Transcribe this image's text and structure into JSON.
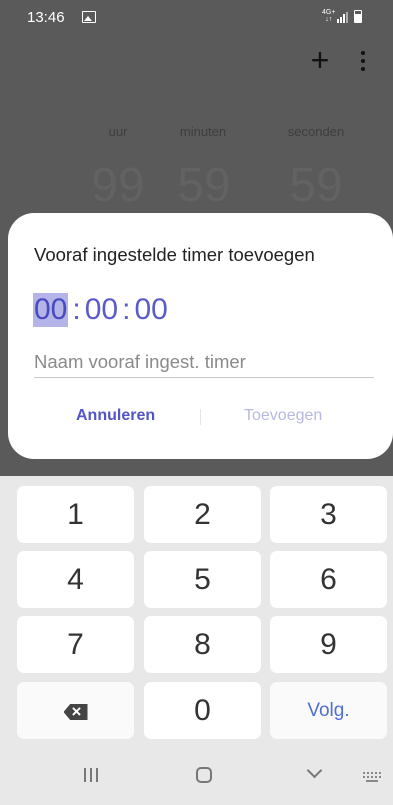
{
  "status_bar": {
    "time": "13:46",
    "network_type": "4G+",
    "icons": [
      "image-icon",
      "network-arrows-icon",
      "signal-icon",
      "battery-icon"
    ]
  },
  "app_bar": {
    "add_icon": "+",
    "more_icon": "more-vertical-icon"
  },
  "background_timer": {
    "columns": [
      {
        "label": "uur",
        "value": "99"
      },
      {
        "label": "minuten",
        "value": "59"
      },
      {
        "label": "seconden",
        "value": "59"
      }
    ]
  },
  "dialog": {
    "title": "Vooraf ingestelde timer toevoegen",
    "hours": "00",
    "minutes": "00",
    "seconds": "00",
    "separator": ":",
    "name_placeholder": "Naam vooraf ingest. timer",
    "name_value": "",
    "cancel_label": "Annuleren",
    "add_label": "Toevoegen",
    "colors": {
      "accent": "#5454c8",
      "highlight": "#b4b4e8",
      "disabled": "#b8b8e4"
    }
  },
  "keypad": {
    "keys": [
      "1",
      "2",
      "3",
      "4",
      "5",
      "6",
      "7",
      "8",
      "9",
      "",
      "0",
      "Volg."
    ],
    "backspace_icon": "backspace-icon"
  },
  "nav_bar": {
    "icons": [
      "recent-apps-icon",
      "home-icon",
      "back-icon",
      "keyboard-icon"
    ]
  }
}
